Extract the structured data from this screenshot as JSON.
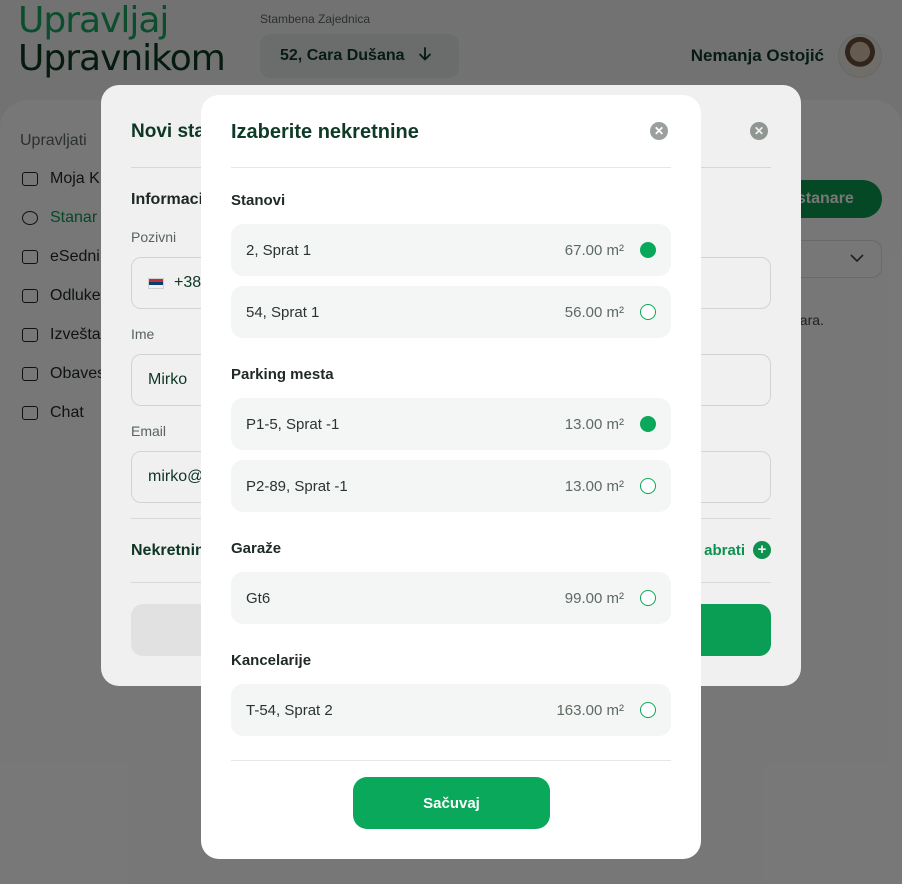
{
  "app": {
    "logo_line1": "Upravljaj",
    "logo_line2": "Upravnikom",
    "community_label": "Stambena Zajednica",
    "community_value": "52, Cara Dušana",
    "user_name": "Nemanja Ostojić"
  },
  "sidebar": {
    "heading": "Upravljati",
    "items": [
      {
        "label": "Moja K"
      },
      {
        "label": "Stanar"
      },
      {
        "label": "eSedni"
      },
      {
        "label": "Odluke"
      },
      {
        "label": "Izvešta"
      },
      {
        "label": "Obaves"
      },
      {
        "label": "Chat"
      }
    ]
  },
  "background": {
    "add_button": "j stanare",
    "note": "nara."
  },
  "modal1": {
    "title": "Novi sta",
    "section": "Informacij",
    "phone_label": "Pozivni",
    "phone_value": "+38",
    "name_label": "Ime",
    "name_value": "Mirko",
    "email_label": "Email",
    "email_value": "mirko@",
    "properties_label": "Nekretnin",
    "choose_label": "abrati"
  },
  "modal2": {
    "title": "Izaberite nekretnine",
    "save_label": "Sačuvaj",
    "groups": [
      {
        "title": "Stanovi",
        "items": [
          {
            "name": "2, Sprat 1",
            "area": "67.00 m²",
            "selected": true
          },
          {
            "name": "54, Sprat 1",
            "area": "56.00 m²",
            "selected": false
          }
        ]
      },
      {
        "title": "Parking mesta",
        "items": [
          {
            "name": "P1-5, Sprat -1",
            "area": "13.00 m²",
            "selected": true
          },
          {
            "name": "P2-89, Sprat -1",
            "area": "13.00 m²",
            "selected": false
          }
        ]
      },
      {
        "title": "Garaže",
        "items": [
          {
            "name": "Gt6",
            "area": "99.00 m²",
            "selected": false
          }
        ]
      },
      {
        "title": "Kancelarije",
        "items": [
          {
            "name": "T-54, Sprat 2",
            "area": "163.00 m²",
            "selected": false
          }
        ]
      }
    ]
  },
  "colors": {
    "brand_green": "#0aa85a",
    "dark_green": "#0f3a27"
  }
}
